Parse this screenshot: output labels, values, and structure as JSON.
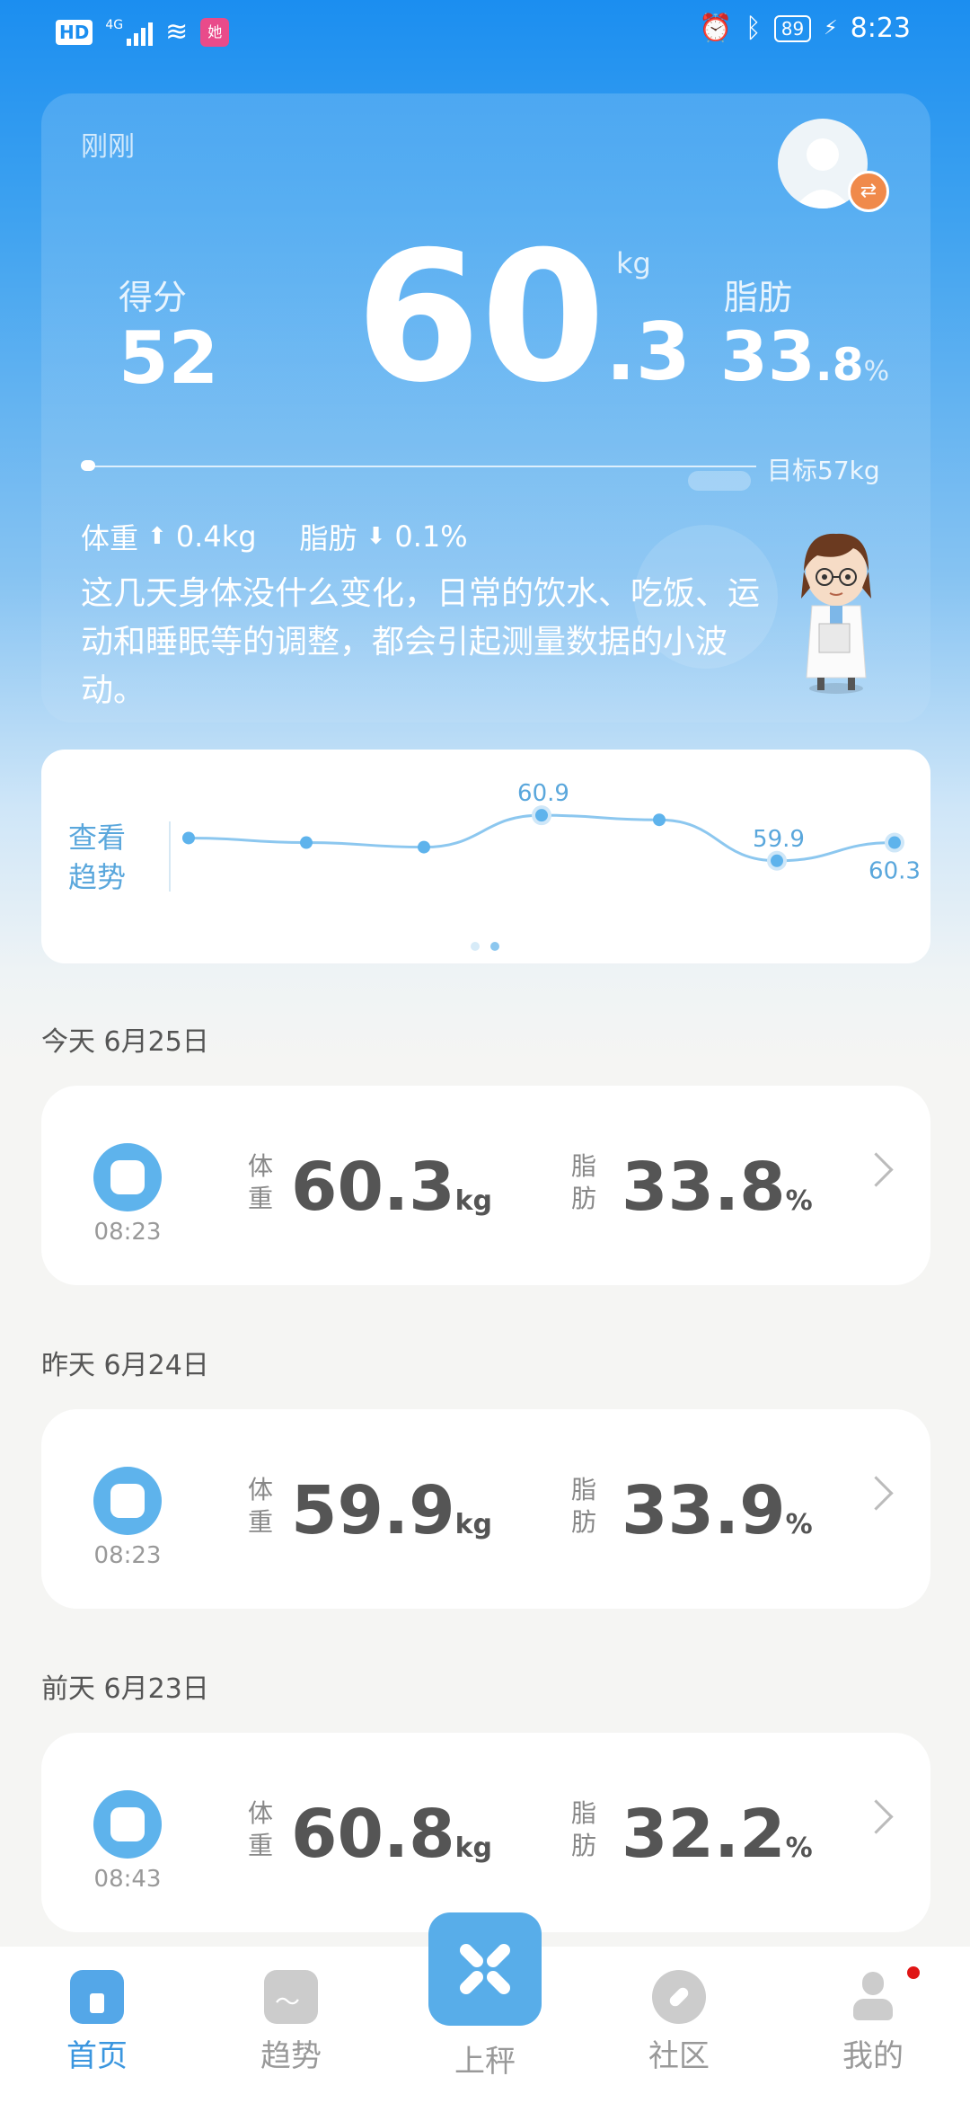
{
  "status_bar": {
    "hd": "HD",
    "network": "4G",
    "app_badge": "她",
    "battery": "89",
    "time": "8:23"
  },
  "hero": {
    "time_ago": "刚刚",
    "score_label": "得分",
    "score": "52",
    "weight_int": "60",
    "weight_dec": ".3",
    "weight_unit": "kg",
    "fat_label": "脂肪",
    "fat_int": "33",
    "fat_dec": ".8",
    "fat_unit": "%",
    "target": "目标57kg",
    "weight_change_label": "体重",
    "weight_change_value": "0.4kg",
    "fat_change_label": "脂肪",
    "fat_change_value": "0.1%",
    "advice": "这几天身体没什么变化，日常的饮水、吃饭、运动和睡眠等的调整，都会引起测量数据的小波动。"
  },
  "trend": {
    "label_line1": "查看",
    "label_line2": "趋势",
    "page_count": 2,
    "active_page": 1,
    "chart_data": {
      "type": "line",
      "values": [
        60.4,
        60.3,
        60.2,
        60.9,
        60.8,
        59.9,
        60.3
      ],
      "labels": [
        "",
        "",
        "",
        "60.9",
        "",
        "59.9",
        "60.3"
      ]
    }
  },
  "records": [
    {
      "day": "今天 6月25日",
      "time": "08:23",
      "weight_label_1": "体",
      "weight_label_2": "重",
      "weight": "60.3",
      "weight_unit": "kg",
      "fat_label_1": "脂",
      "fat_label_2": "肪",
      "fat": "33.8",
      "fat_unit": "%"
    },
    {
      "day": "昨天 6月24日",
      "time": "08:23",
      "weight_label_1": "体",
      "weight_label_2": "重",
      "weight": "59.9",
      "weight_unit": "kg",
      "fat_label_1": "脂",
      "fat_label_2": "肪",
      "fat": "33.9",
      "fat_unit": "%"
    },
    {
      "day": "前天 6月23日",
      "time": "08:43",
      "weight_label_1": "体",
      "weight_label_2": "重",
      "weight": "60.8",
      "weight_unit": "kg",
      "fat_label_1": "脂",
      "fat_label_2": "肪",
      "fat": "32.2",
      "fat_unit": "%"
    }
  ],
  "nav": {
    "home": "首页",
    "trend": "趋势",
    "weigh": "上秤",
    "community": "社区",
    "mine": "我的"
  },
  "colors": {
    "brand": "#3a96df",
    "accent": "#5eb3ec",
    "notification": "#e01515"
  }
}
